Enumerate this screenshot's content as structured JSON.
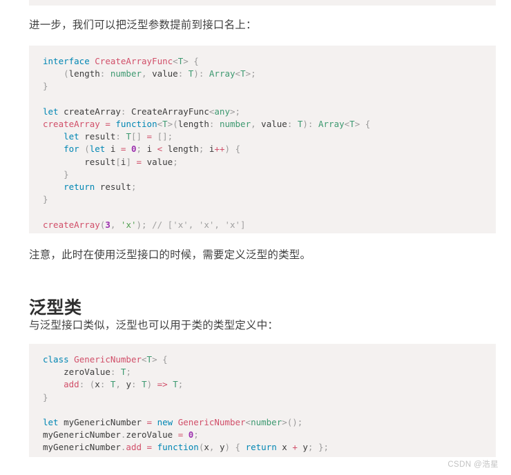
{
  "article": {
    "paragraph_1": "进一步，我们可以把泛型参数提前到接口名上：",
    "paragraph_2": "注意，此时在使用泛型接口的时候，需要定义泛型的类型。",
    "heading_generic_class": "泛型类",
    "paragraph_3": "与泛型接口类似，泛型也可以用于类的类型定义中："
  },
  "code_block_1": {
    "language": "typescript",
    "lines": [
      "interface CreateArrayFunc<T> {",
      "    (length: number, value: T): Array<T>;",
      "}",
      "",
      "let createArray: CreateArrayFunc<any>;",
      "createArray = function<T>(length: number, value: T): Array<T> {",
      "    let result: T[] = [];",
      "    for (let i = 0; i < length; i++) {",
      "        result[i] = value;",
      "    }",
      "    return result;",
      "}",
      "",
      "createArray(3, 'x'); // ['x', 'x', 'x']"
    ]
  },
  "code_block_2": {
    "language": "typescript",
    "lines": [
      "class GenericNumber<T> {",
      "    zeroValue: T;",
      "    add: (x: T, y: T) => T;",
      "}",
      "",
      "let myGenericNumber = new GenericNumber<number>();",
      "myGenericNumber.zeroValue = 0;",
      "myGenericNumber.add = function(x, y) { return x + y; };"
    ]
  },
  "watermark": {
    "text": "CSDN @浩星"
  },
  "colors": {
    "code_background": "#f4f1f0",
    "page_background": "#ffffff",
    "keyword": "#0086b3",
    "type_name": "#d14f69",
    "builtin_type": "#3d9970",
    "number_literal": "#9b2fae",
    "string_literal": "#4f9e4f",
    "comment": "#a0a0a0",
    "body_text": "#3f3f3f",
    "heading_text": "#2f2f2f",
    "watermark_text": "#c2c2c2"
  }
}
